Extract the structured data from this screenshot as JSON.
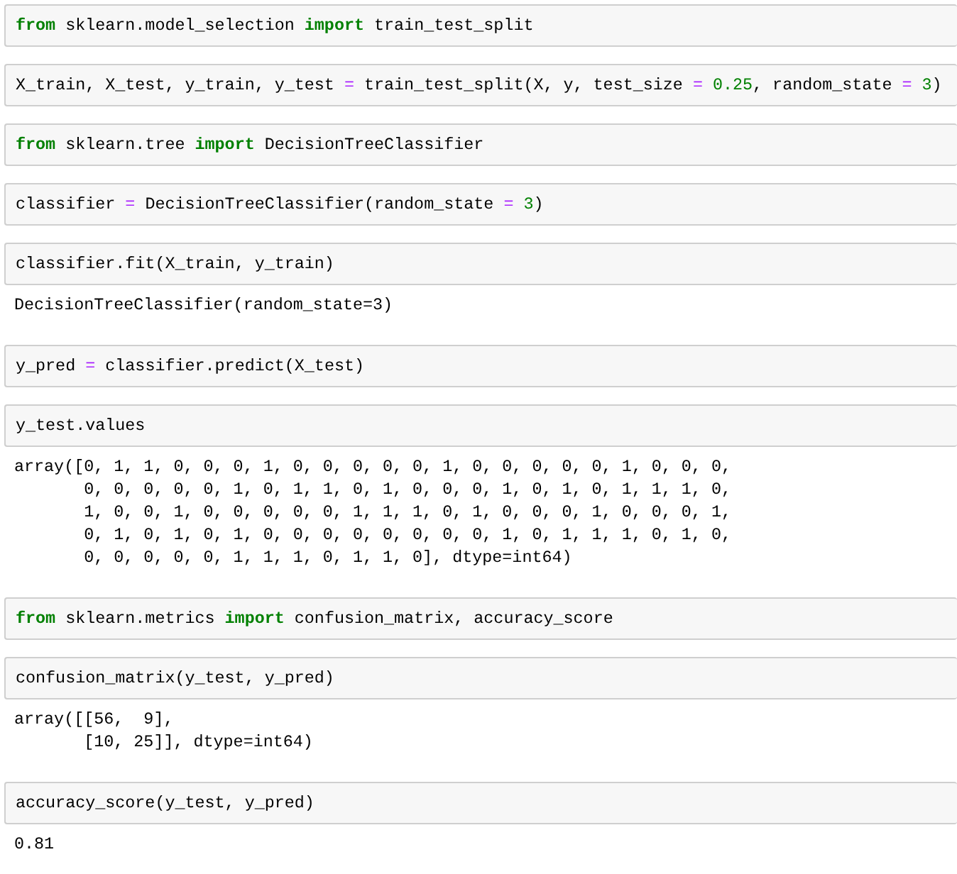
{
  "cells": [
    {
      "input": [
        {
          "text": "from",
          "kind": "keyword"
        },
        {
          "text": " sklearn.model_selection ",
          "kind": "name"
        },
        {
          "text": "import",
          "kind": "keyword"
        },
        {
          "text": " train_test_split",
          "kind": "name"
        }
      ]
    },
    {
      "input": [
        {
          "text": "X_train, X_test, y_train, y_test ",
          "kind": "name"
        },
        {
          "text": "= ",
          "kind": "operator"
        },
        {
          "text": "train_test_split(X, y, test_size ",
          "kind": "name"
        },
        {
          "text": "= ",
          "kind": "operator"
        },
        {
          "text": "0.25",
          "kind": "number"
        },
        {
          "text": ", random_state ",
          "kind": "name"
        },
        {
          "text": "= ",
          "kind": "operator"
        },
        {
          "text": "3",
          "kind": "number"
        },
        {
          "text": ")",
          "kind": "name"
        }
      ]
    },
    {
      "input": [
        {
          "text": "from",
          "kind": "keyword"
        },
        {
          "text": " sklearn.tree ",
          "kind": "name"
        },
        {
          "text": "import",
          "kind": "keyword"
        },
        {
          "text": " DecisionTreeClassifier",
          "kind": "name"
        }
      ]
    },
    {
      "input": [
        {
          "text": "classifier ",
          "kind": "name"
        },
        {
          "text": "= ",
          "kind": "operator"
        },
        {
          "text": "DecisionTreeClassifier(random_state ",
          "kind": "name"
        },
        {
          "text": "= ",
          "kind": "operator"
        },
        {
          "text": "3",
          "kind": "number"
        },
        {
          "text": ")",
          "kind": "name"
        }
      ]
    },
    {
      "input": [
        {
          "text": "classifier.fit(X_train, y_train)",
          "kind": "name"
        }
      ],
      "output": [
        "DecisionTreeClassifier(random_state=3)"
      ]
    },
    {
      "input": [
        {
          "text": "y_pred ",
          "kind": "name"
        },
        {
          "text": "= ",
          "kind": "operator"
        },
        {
          "text": "classifier.predict(X_test)",
          "kind": "name"
        }
      ]
    },
    {
      "input": [
        {
          "text": "y_test.values",
          "kind": "name"
        }
      ],
      "output": [
        "array([0, 1, 1, 0, 0, 0, 1, 0, 0, 0, 0, 0, 1, 0, 0, 0, 0, 0, 1, 0, 0, 0,",
        "       0, 0, 0, 0, 0, 1, 0, 1, 1, 0, 1, 0, 0, 0, 1, 0, 1, 0, 1, 1, 1, 0,",
        "       1, 0, 0, 1, 0, 0, 0, 0, 0, 1, 1, 1, 0, 1, 0, 0, 0, 1, 0, 0, 0, 1,",
        "       0, 1, 0, 1, 0, 1, 0, 0, 0, 0, 0, 0, 0, 0, 1, 0, 1, 1, 1, 0, 1, 0,",
        "       0, 0, 0, 0, 0, 1, 1, 1, 0, 1, 1, 0], dtype=int64)"
      ]
    },
    {
      "input": [
        {
          "text": "from",
          "kind": "keyword"
        },
        {
          "text": " sklearn.metrics ",
          "kind": "name"
        },
        {
          "text": "import",
          "kind": "keyword"
        },
        {
          "text": " confusion_matrix, accuracy_score",
          "kind": "name"
        }
      ]
    },
    {
      "input": [
        {
          "text": "confusion_matrix(y_test, y_pred)",
          "kind": "name"
        }
      ],
      "output": [
        "array([[56,  9],",
        "       [10, 25]], dtype=int64)"
      ]
    },
    {
      "input": [
        {
          "text": "accuracy_score(y_test, y_pred)",
          "kind": "name"
        }
      ],
      "output": [
        "0.81"
      ]
    }
  ]
}
